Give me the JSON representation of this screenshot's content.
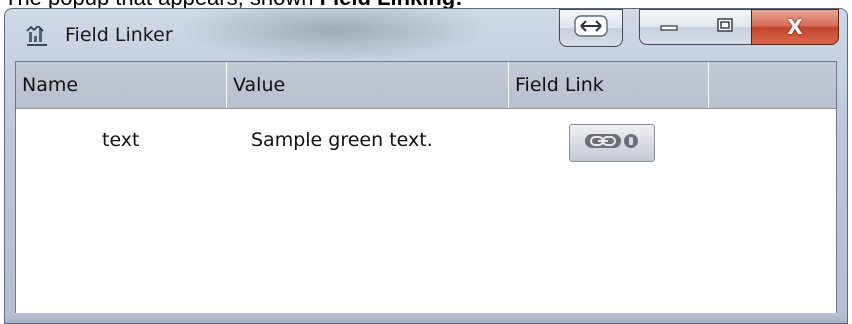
{
  "top_caption": {
    "text_before": "The popup that appears, shown ",
    "text_bold": "Field Linking:"
  },
  "window": {
    "title": "Field Linker",
    "icon": "field-linker-app-icon",
    "controls": {
      "resize_icon": "double-arrow-icon",
      "minimize_icon": "minimize-icon",
      "maximize_icon": "maximize-icon",
      "close_label": "X"
    }
  },
  "grid": {
    "columns": [
      "Name",
      "Value",
      "Field Link",
      ""
    ],
    "rows": [
      {
        "name": "text",
        "value": "Sample green text.",
        "field_link_icon": "chain-link-icon"
      }
    ]
  },
  "colors": {
    "header_bg": "#bcc2cf",
    "close_button": "#c84a30",
    "window_frame": "#bcc8d8"
  }
}
